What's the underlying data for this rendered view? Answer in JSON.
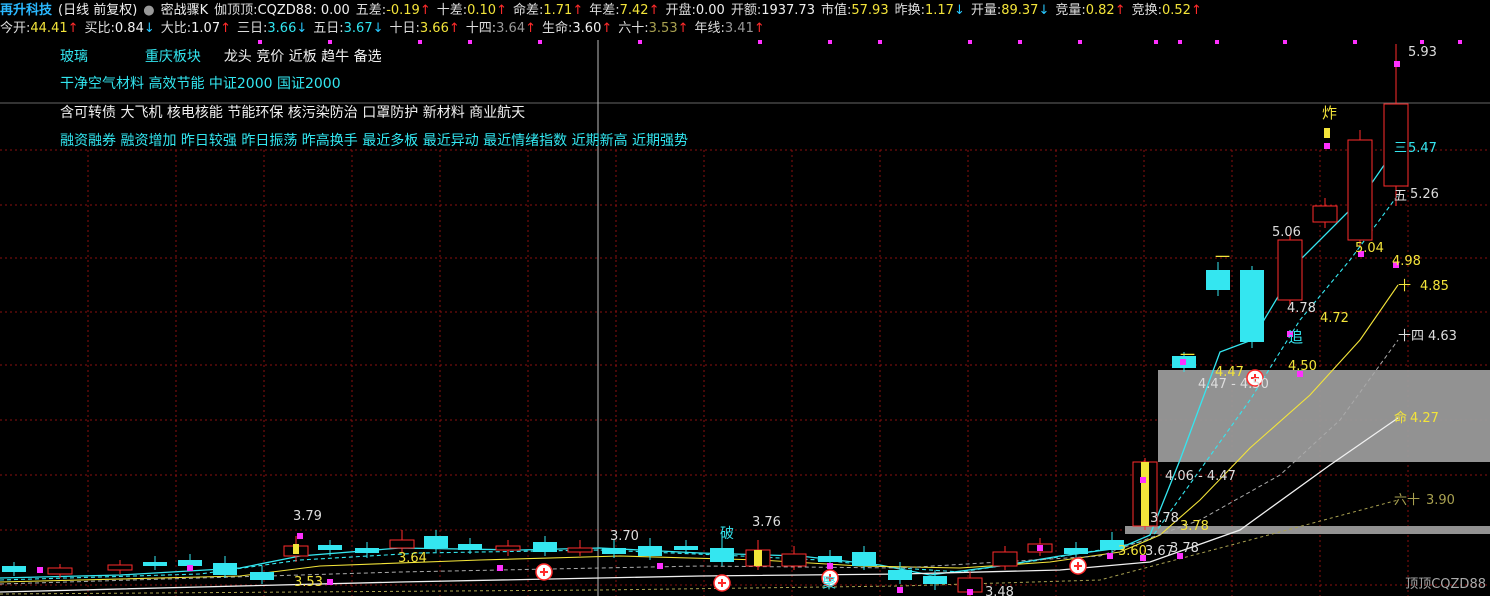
{
  "header": {
    "stock_name": "再升科技",
    "period": "(日线 前复权)",
    "indicator_name": "密战骤K",
    "items": [
      {
        "label": "伽顶顶:",
        "value": "CQZD88: 0.00",
        "cls": "white",
        "arrow": ""
      },
      {
        "label": "五差:",
        "value": "-0.19",
        "cls": "yellow",
        "arrow": "↑"
      },
      {
        "label": "十差:",
        "value": "0.10",
        "cls": "yellow",
        "arrow": "↑"
      },
      {
        "label": "命差:",
        "value": "1.71",
        "cls": "yellow",
        "arrow": "↑"
      },
      {
        "label": "年差:",
        "value": "7.42",
        "cls": "yellow",
        "arrow": "↑"
      },
      {
        "label": "开盘:",
        "value": "0.00",
        "cls": "white",
        "arrow": ""
      },
      {
        "label": "开额:",
        "value": "1937.73",
        "cls": "white",
        "arrow": ""
      },
      {
        "label": "市值:",
        "value": "57.93",
        "cls": "yellow",
        "arrow": ""
      },
      {
        "label": "昨换:",
        "value": "1.17",
        "cls": "yellow",
        "arrow": "↓"
      },
      {
        "label": "开量:",
        "value": "89.37",
        "cls": "yellow",
        "arrow": "↓"
      },
      {
        "label": "竞量:",
        "value": "0.82",
        "cls": "yellow",
        "arrow": "↑"
      },
      {
        "label": "竞换:",
        "value": "0.52",
        "cls": "yellow",
        "arrow": "↑"
      }
    ],
    "row2": [
      {
        "label": "今开:",
        "value": "44.41",
        "cls": "yellow",
        "arrow": "↑"
      },
      {
        "label": "买比:",
        "value": "0.84",
        "cls": "white",
        "arrow": "↓"
      },
      {
        "label": "大比:",
        "value": "1.07",
        "cls": "white",
        "arrow": "↑"
      },
      {
        "label": "三日:",
        "value": "3.66",
        "cls": "cyan",
        "arrow": "↓"
      },
      {
        "label": "五日:",
        "value": "3.67",
        "cls": "cyan",
        "arrow": "↓"
      },
      {
        "label": "十日:",
        "value": "3.66",
        "cls": "yellow",
        "arrow": "↑"
      },
      {
        "label": "十四:",
        "value": "3.64",
        "cls": "gray",
        "arrow": "↑"
      },
      {
        "label": "生命:",
        "value": "3.60",
        "cls": "white",
        "arrow": "↑"
      },
      {
        "label": "六十:",
        "value": "3.53",
        "cls": "olive",
        "arrow": "↑"
      },
      {
        "label": "年线:",
        "value": "3.41",
        "cls": "gray",
        "arrow": "↑"
      }
    ]
  },
  "boards": {
    "row1": [
      {
        "text": "玻璃",
        "cls": "cyan"
      },
      {
        "text": "重庆板块",
        "cls": "cyan"
      },
      {
        "text": "龙头 竞价 近板 趋牛 备选",
        "cls": "white"
      }
    ],
    "row2": "干净空气材料 高效节能 中证2000 国证2000",
    "row3": "含可转债 大飞机 核电核能 节能环保 核污染防治 口罩防护 新材料 商业航天",
    "row4": "融资融券 融资增加 昨日较强 昨日振荡 昨高换手 最近多板 最近异动 最近情绪指数 近期新高 近期强势"
  },
  "chart_labels": {
    "high_price": "5.93",
    "ma3_value": "5.47",
    "ma5_value": "5.26",
    "ma10_value": "4.85",
    "ma14_value": "4.63",
    "life_value": "4.27",
    "ma60_value": "3.90",
    "label_504": "5.04",
    "label_498": "4.98",
    "label_506": "5.06",
    "label_478": "4.78",
    "label_472": "4.72",
    "label_450": "4.50",
    "label_447": "4.47",
    "zone_upper": "4.47 - 4.50",
    "zone_lower": "4.06 - 4.47",
    "label_378a": "3.78",
    "label_378b": "3.78",
    "label_378c": "3.78",
    "label_348": "3.48",
    "label_379": "3.79",
    "label_376": "3.76",
    "label_370": "3.70",
    "label_364": "3.64",
    "label_353": "3.53",
    "label_360": "3.60",
    "label_367": "3.67",
    "tag_zha": "炸",
    "tag_zhui": "追",
    "tag_po": "破",
    "tag_san": "三",
    "tag_wu": "五",
    "tag_shi": "十",
    "tag_shisi": "十四",
    "tag_ming": "命",
    "tag_liushi": "六十",
    "tag_yi": "一",
    "tag_ju": "聚",
    "watermark": "顶顶CQZD88"
  },
  "colors": {
    "up": "#ff2b2b",
    "down": "#34e6f0",
    "ma3": "#34e6f0",
    "ma10": "#f3e43a",
    "life": "#f0f0f0",
    "ma14": "#aaaaaa",
    "ma60": "#a8a050",
    "magenta": "#ff30ff"
  }
}
